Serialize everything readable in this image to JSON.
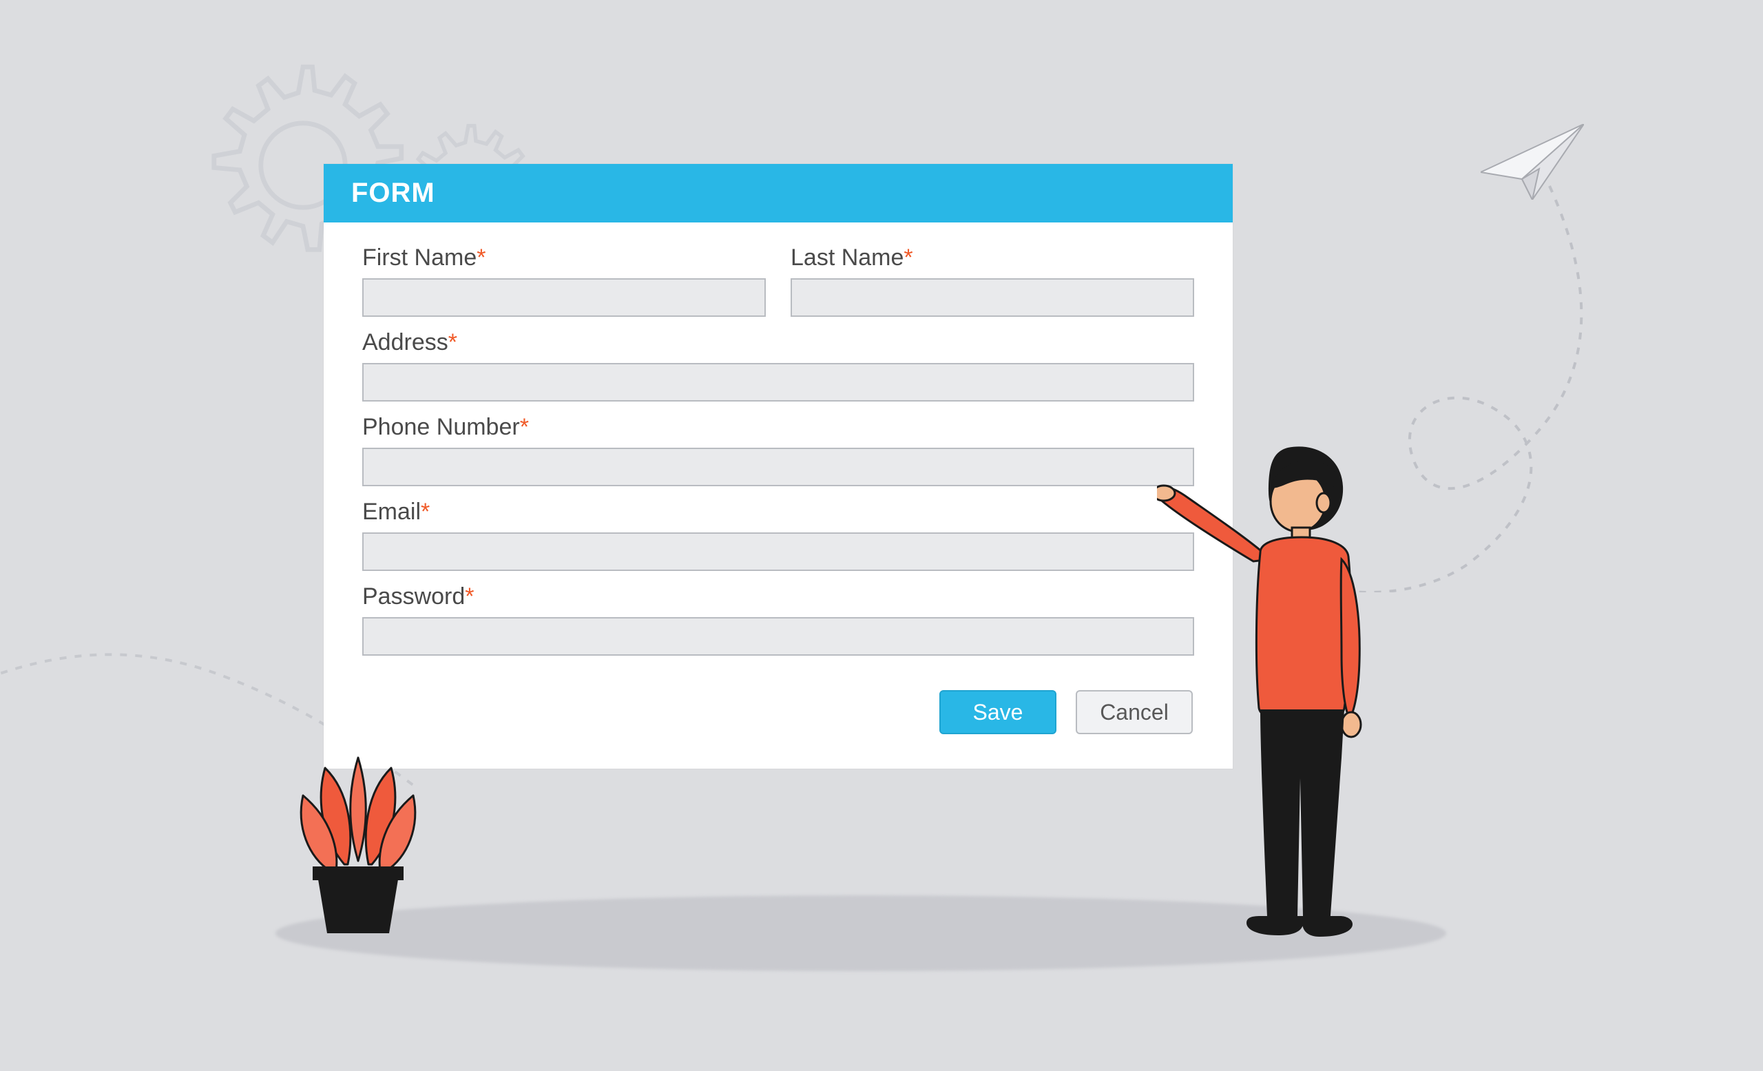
{
  "form": {
    "title": "FORM",
    "fields": {
      "first_name": {
        "label": "First Name",
        "required": "*",
        "value": ""
      },
      "last_name": {
        "label": "Last Name",
        "required": "*",
        "value": ""
      },
      "address": {
        "label": "Address",
        "required": "*",
        "value": ""
      },
      "phone": {
        "label": "Phone Number",
        "required": "*",
        "value": ""
      },
      "email": {
        "label": "Email",
        "required": "*",
        "value": ""
      },
      "password": {
        "label": "Password",
        "required": "*",
        "value": ""
      }
    },
    "actions": {
      "save_label": "Save",
      "cancel_label": "Cancel"
    }
  },
  "colors": {
    "accent": "#29b7e6",
    "required": "#f05a28",
    "person_shirt": "#f05a42",
    "plant": "#f05a42"
  }
}
